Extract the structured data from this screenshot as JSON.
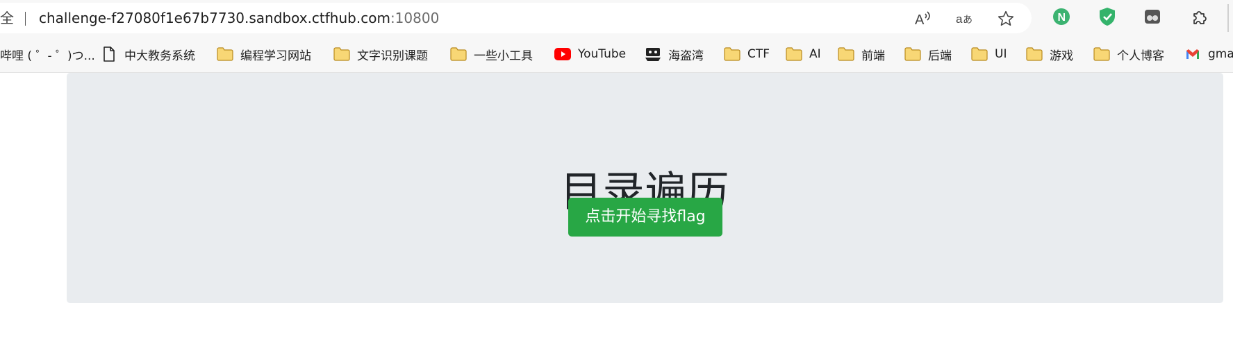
{
  "address_bar": {
    "security_label": "全",
    "url_host": "challenge-f27080f1e67b7730.sandbox.ctfhub.com",
    "url_port": ":10800",
    "icons": [
      "read-aloud-icon",
      "translate-icon",
      "favorite-star-icon"
    ]
  },
  "extensions": [
    "extension-n-icon",
    "extension-shield-icon",
    "extension-app-icon",
    "extensions-puzzle-icon"
  ],
  "bookmarks": [
    {
      "label": "哔哩 ( ゜- ゜)つ...",
      "icon": "none"
    },
    {
      "label": "中大教务系统",
      "icon": "page-icon"
    },
    {
      "label": "编程学习网站",
      "icon": "folder-icon"
    },
    {
      "label": "文字识别课题",
      "icon": "folder-icon"
    },
    {
      "label": "一些小工具",
      "icon": "folder-icon"
    },
    {
      "label": "YouTube",
      "icon": "youtube-icon"
    },
    {
      "label": "海盗湾",
      "icon": "pirate-ship-icon"
    },
    {
      "label": "CTF",
      "icon": "folder-icon"
    },
    {
      "label": "AI",
      "icon": "folder-icon"
    },
    {
      "label": "前端",
      "icon": "folder-icon"
    },
    {
      "label": "后端",
      "icon": "folder-icon"
    },
    {
      "label": "UI",
      "icon": "folder-icon"
    },
    {
      "label": "游戏",
      "icon": "folder-icon"
    },
    {
      "label": "个人博客",
      "icon": "folder-icon"
    },
    {
      "label": "gma",
      "icon": "gmail-icon"
    }
  ],
  "page": {
    "title": "目录遍历",
    "button_label": "点击开始寻找flag",
    "button_color": "#28a745",
    "panel_color": "#e9ecef"
  }
}
